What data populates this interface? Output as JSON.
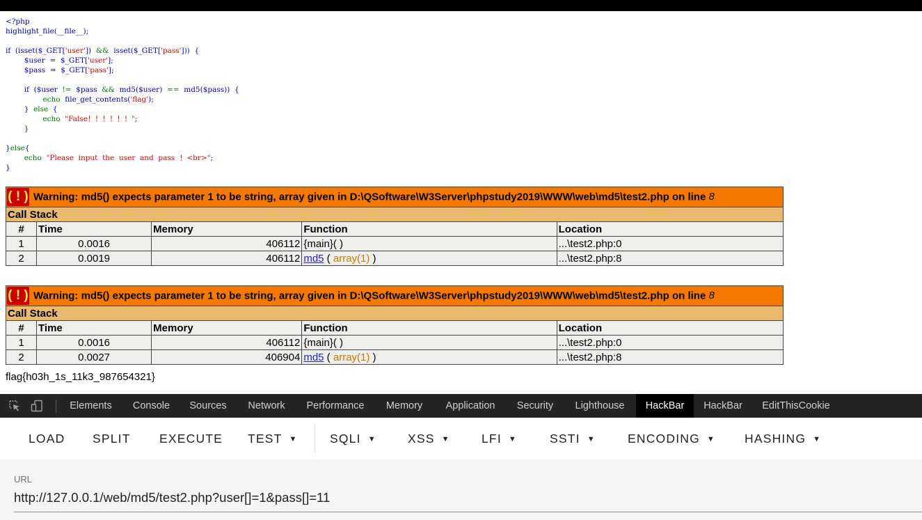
{
  "source_code": [
    [
      [
        "t",
        "<?php"
      ]
    ],
    [
      [
        "t",
        "highlight_file(__file__);"
      ]
    ],
    [
      [
        "t",
        ""
      ]
    ],
    [
      [
        "t",
        "if  (isset($_GET["
      ],
      [
        "s",
        "'user'"
      ],
      [
        "t",
        "])  "
      ],
      [
        "k",
        "&&"
      ],
      [
        "t",
        "  isset($_GET["
      ],
      [
        "s",
        "'pass'"
      ],
      [
        "t",
        "]))  {"
      ]
    ],
    [
      [
        "t",
        "        $user  =  $_GET["
      ],
      [
        "s",
        "'user'"
      ],
      [
        "t",
        "];"
      ]
    ],
    [
      [
        "t",
        "        $pass  =  $_GET["
      ],
      [
        "s",
        "'pass'"
      ],
      [
        "t",
        "];"
      ]
    ],
    [
      [
        "t",
        ""
      ]
    ],
    [
      [
        "t",
        "        if  ($user  "
      ],
      [
        "k",
        "!="
      ],
      [
        "t",
        "  $pass  "
      ],
      [
        "k",
        "&&"
      ],
      [
        "t",
        "  md5($user)  "
      ],
      [
        "k",
        "=="
      ],
      [
        "t",
        "  md5($pass))  {"
      ]
    ],
    [
      [
        "k",
        "                echo"
      ],
      [
        "t",
        "  file_get_contents("
      ],
      [
        "s",
        "'flag'"
      ],
      [
        "t",
        ");"
      ]
    ],
    [
      [
        "t",
        "        }  "
      ],
      [
        "k",
        "else"
      ],
      [
        "t",
        "  {"
      ]
    ],
    [
      [
        "k",
        "                echo"
      ],
      [
        "t",
        "  "
      ],
      [
        "s",
        "\"False！！！！！！\""
      ],
      [
        "t",
        ";"
      ]
    ],
    [
      [
        "t",
        "        }"
      ]
    ],
    [
      [
        "t",
        ""
      ]
    ],
    [
      [
        "t",
        "}"
      ],
      [
        "k",
        "else"
      ],
      [
        "t",
        "{"
      ]
    ],
    [
      [
        "k",
        "        echo"
      ],
      [
        "t",
        "  "
      ],
      [
        "s",
        "\"Please  input  the  user  and  pass  ！<br>\""
      ],
      [
        "t",
        ";"
      ]
    ],
    [
      [
        "t",
        "}"
      ]
    ]
  ],
  "warnings": [
    {
      "icon": "( ! )",
      "message": "Warning: md5() expects parameter 1 to be string, array given in D:\\QSoftware\\W3Server\\phpstudy2019\\WWW\\web\\md5\\test2.php on line ",
      "line": "8",
      "call_stack_label": "Call Stack",
      "headers": {
        "num": "#",
        "time": "Time",
        "memory": "Memory",
        "function": "Function",
        "location": "Location"
      },
      "rows": [
        {
          "num": "1",
          "time": "0.0016",
          "memory": "406112",
          "func": "{main}( )",
          "func_link": "",
          "args_open": "",
          "args": "",
          "args_close": "",
          "location": "...\\test2.php:0"
        },
        {
          "num": "2",
          "time": "0.0019",
          "memory": "406112",
          "func": "",
          "func_link": "md5",
          "args_open": " ( ",
          "args": "array(1)",
          "args_close": " )",
          "location": "...\\test2.php:8"
        }
      ]
    },
    {
      "icon": "( ! )",
      "message": "Warning: md5() expects parameter 1 to be string, array given in D:\\QSoftware\\W3Server\\phpstudy2019\\WWW\\web\\md5\\test2.php on line ",
      "line": "8",
      "call_stack_label": "Call Stack",
      "headers": {
        "num": "#",
        "time": "Time",
        "memory": "Memory",
        "function": "Function",
        "location": "Location"
      },
      "rows": [
        {
          "num": "1",
          "time": "0.0016",
          "memory": "406112",
          "func": "{main}( )",
          "func_link": "",
          "args_open": "",
          "args": "",
          "args_close": "",
          "location": "...\\test2.php:0"
        },
        {
          "num": "2",
          "time": "0.0027",
          "memory": "406904",
          "func": "",
          "func_link": "md5",
          "args_open": " ( ",
          "args": "array(1)",
          "args_close": " )",
          "location": "...\\test2.php:8"
        }
      ]
    }
  ],
  "flag_output": "flag{h03h_1s_11k3_987654321}",
  "devtools": {
    "inspect_icon": "cursor-select-icon",
    "device_icon": "device-toggle-icon",
    "tabs": [
      "Elements",
      "Console",
      "Sources",
      "Network",
      "Performance",
      "Memory",
      "Application",
      "Security",
      "Lighthouse",
      "HackBar",
      "HackBar",
      "EditThisCookie"
    ],
    "active_tab": "HackBar"
  },
  "hackbar": {
    "buttons": [
      {
        "label": "LOAD",
        "dropdown": false
      },
      {
        "label": "SPLIT",
        "dropdown": false
      },
      {
        "label": "EXECUTE",
        "dropdown": false
      },
      {
        "label": "TEST",
        "dropdown": true
      },
      {
        "label": "SQLI",
        "dropdown": true
      },
      {
        "label": "XSS",
        "dropdown": true
      },
      {
        "label": "LFI",
        "dropdown": true
      },
      {
        "label": "SSTI",
        "dropdown": true
      },
      {
        "label": "ENCODING",
        "dropdown": true
      },
      {
        "label": "HASHING",
        "dropdown": true
      }
    ],
    "url_label": "URL",
    "url_value": "http://127.0.0.1/web/md5/test2.php?user[]=1&pass[]=11"
  },
  "colors": {
    "warning_bg": "#f57900",
    "callstack_bg": "#e9b96e",
    "row_bg": "#eeeeec",
    "code_default": "#0000bb",
    "code_string": "#dd0000",
    "code_keyword": "#007700",
    "devtools_bg": "#242424"
  }
}
